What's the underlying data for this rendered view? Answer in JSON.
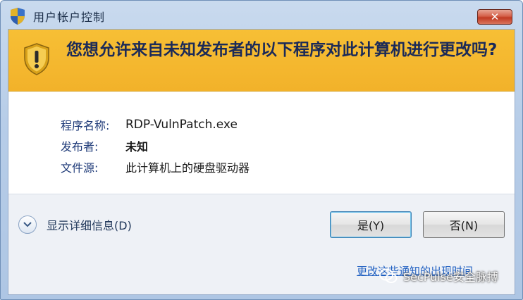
{
  "window": {
    "title": "用户帐户控制",
    "close_label": "✕"
  },
  "banner": {
    "question": "您想允许来自未知发布者的以下程序对此计算机进行更改吗?"
  },
  "info": {
    "program_label": "程序名称:",
    "program_value": "RDP-VulnPatch.exe",
    "publisher_label": "发布者:",
    "publisher_value": "未知",
    "source_label": "文件源:",
    "source_value": "此计算机上的硬盘驱动器"
  },
  "footer": {
    "details_label": "显示详细信息(D)",
    "yes_label": "是(Y)",
    "no_label": "否(N)",
    "link_text": "更改这些通知的出现时间"
  },
  "watermark": {
    "text": "SecPulse安全脉搏"
  },
  "colors": {
    "banner": "#f2b22a",
    "link": "#1f5fc1",
    "close": "#c13a22"
  }
}
